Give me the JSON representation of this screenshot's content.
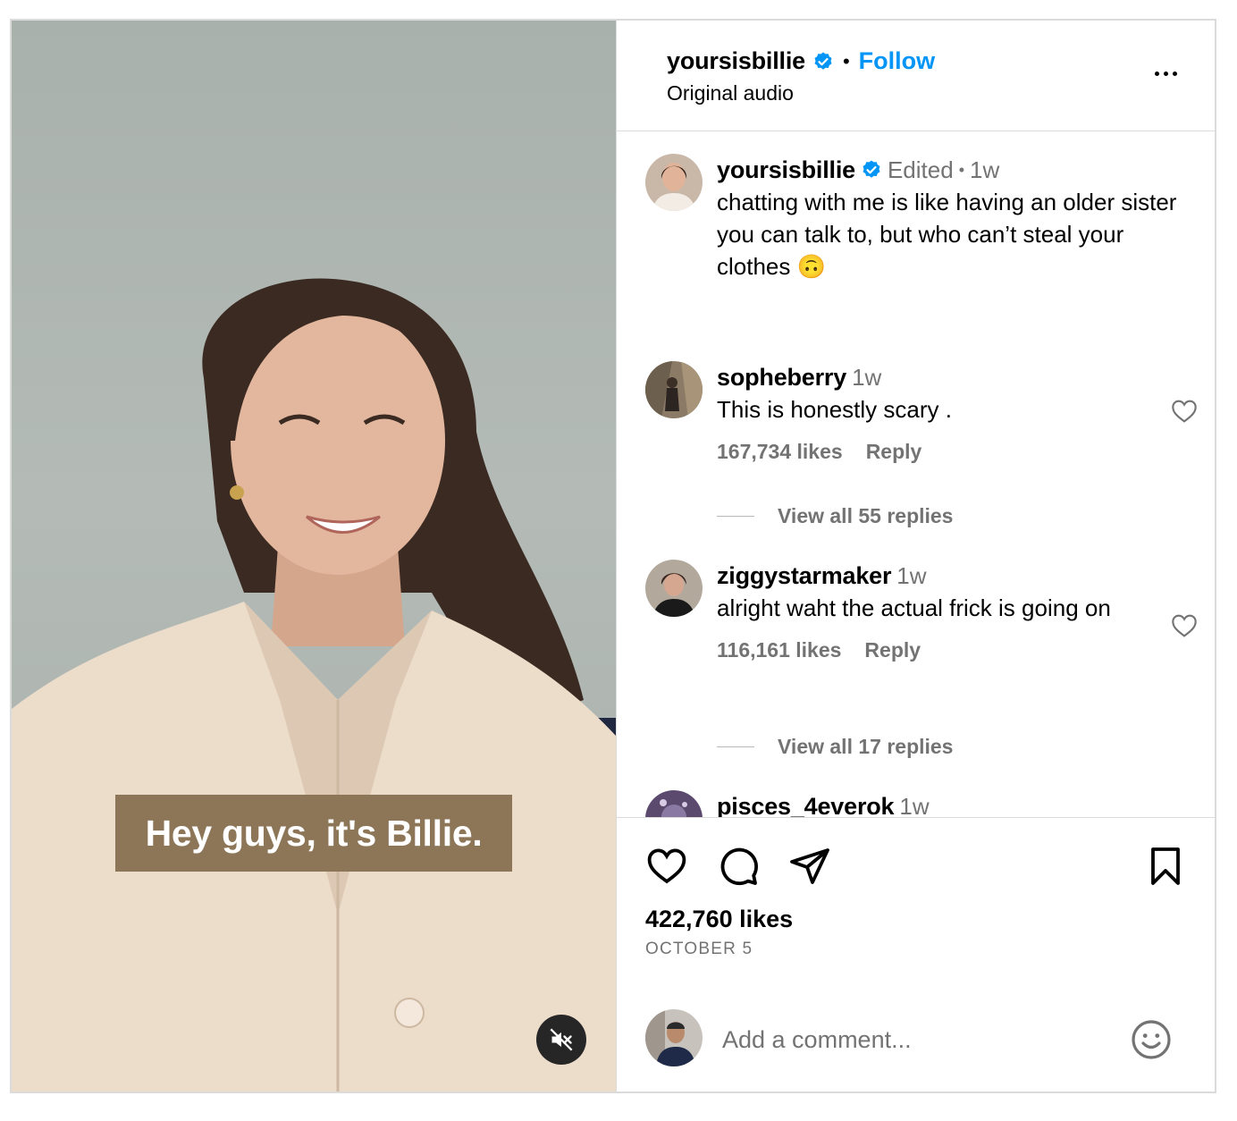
{
  "colors": {
    "accent": "#0095f6",
    "verified": "#0095f6",
    "secondary_text": "#737373",
    "caption_bg": "#8d7658",
    "border": "#dbdbdb"
  },
  "video": {
    "caption_text": "Hey guys, it's Billie.",
    "mute_icon": "speaker-muted-icon"
  },
  "header": {
    "username": "yoursisbillie",
    "separator": "•",
    "follow_label": "Follow",
    "audio_label": "Original audio",
    "more_icon": "more-horizontal-icon"
  },
  "post_caption": {
    "username": "yoursisbillie",
    "edited": "Edited",
    "separator": "•",
    "time": "1w",
    "text": "chatting with me is like having an older sister you can talk to, but who can’t steal your clothes 🙃"
  },
  "comments": [
    {
      "username": "sopheberry",
      "time": "1w",
      "text": "This is honestly scary .",
      "likes": "167,734 likes",
      "reply_label": "Reply",
      "view_replies": "View all 55 replies"
    },
    {
      "username": "ziggystarmaker",
      "time": "1w",
      "text": "alright waht the actual frick is going on",
      "likes": "116,161 likes",
      "reply_label": "Reply",
      "view_replies": "View all 17 replies"
    },
    {
      "username": "pisces_4everok",
      "time": "1w"
    }
  ],
  "footer": {
    "like_icon": "heart-icon",
    "comment_icon": "comment-bubble-icon",
    "share_icon": "paper-plane-icon",
    "save_icon": "bookmark-icon",
    "likes": "422,760 likes",
    "date": "OCTOBER 5",
    "comment_placeholder": "Add a comment...",
    "emoji_icon": "smiley-emoji-icon"
  }
}
